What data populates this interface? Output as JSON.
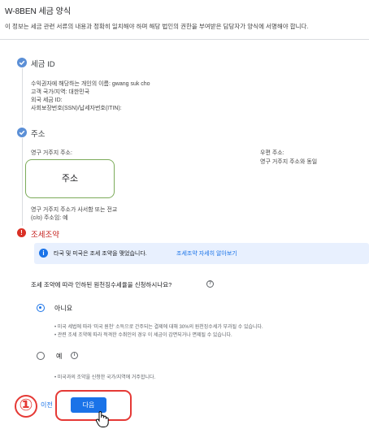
{
  "header": {
    "title": "W-8BEN 세금 양식",
    "intro": "이 정보는 세금 관련 서류의 내용과 정확히 일치해야 하며 해당 법인의 권한을 부여받은 담당자가 양식에 서명해야 합니다."
  },
  "tax_id": {
    "title": "세금 ID",
    "lines": [
      "수익권자에 해당하는 개인의 이름: gwang suk cho",
      "고객 국가/지역: 대한민국",
      "외국 세금 ID:",
      "사회보장번호(SSN)/납세자번호(ITIN):"
    ]
  },
  "address": {
    "title": "주소",
    "permanent_label": "영구 거주지 주소:",
    "mailing_label": "우편 주소:",
    "mailing_value": "영구 거주지 주소와 동일",
    "box_text": "주소",
    "note_1": "영구 거주지 주소가 사서함 또는 전교",
    "note_2": "(c/o) 주소임: 예"
  },
  "treaty": {
    "title": "조세조약",
    "info_text": "타국 및 미국은 조세 조약을 맺었습니다.",
    "info_link": "조세조약 자세히 알아보기",
    "question": "조세 조약에 따라 인하된 원천징수세율을 신청하시나요?",
    "option_no": "아니요",
    "option_no_bullets": [
      "미국 세법에 따라 '미국 원천' 소득으로 간주되는 결제에 대해 30%의 원천징수세가 부과될 수 있습니다.",
      "관련 조세 조약에 따라 적격한 수취인의 경우 이 세금이 감면되거나 면제될 수 있습니다."
    ],
    "option_yes": "예",
    "option_yes_bullets": [
      "미국과의 조약을 신청한 국가/지역에 거주합니다."
    ],
    "selected": "아니요"
  },
  "footer": {
    "prev_label": "이전",
    "next_label": "다음",
    "annotation_number": "①"
  },
  "colors": {
    "accent": "#1a73e8",
    "check": "#5b8fd6",
    "error": "#d93025",
    "highlight": "#e53935"
  }
}
